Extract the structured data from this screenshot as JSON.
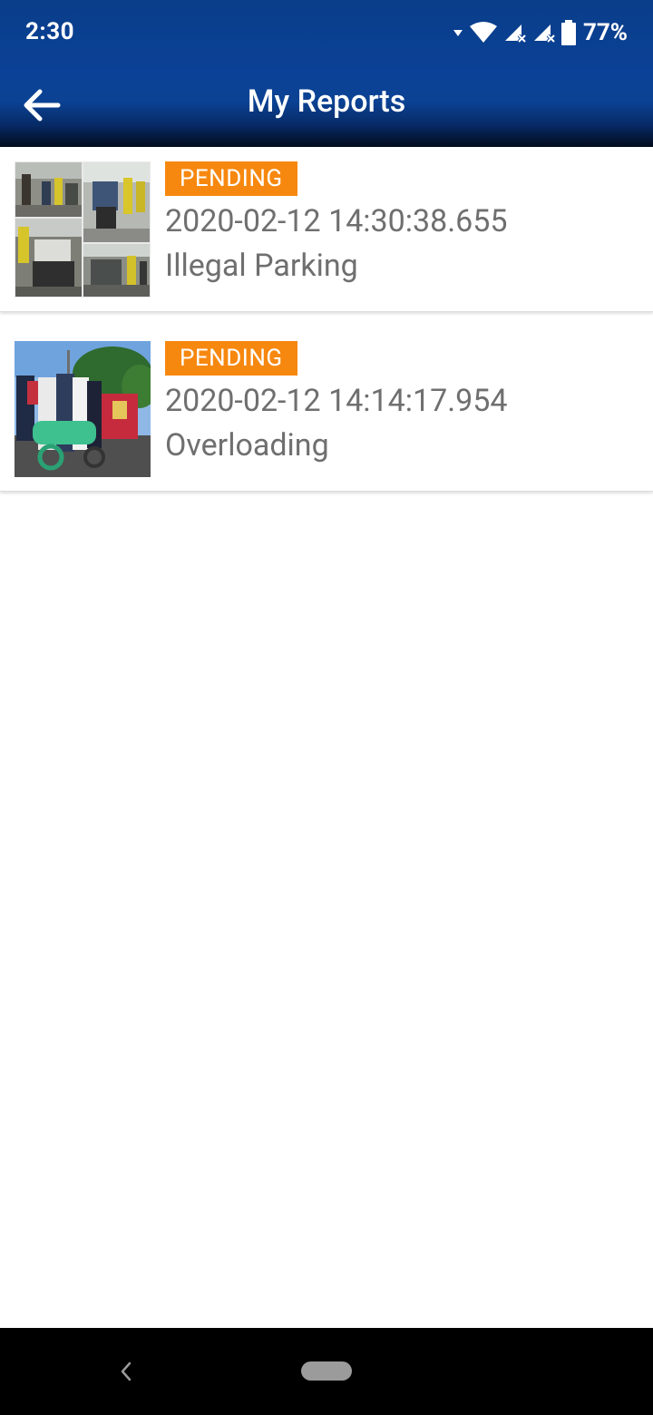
{
  "status_bar": {
    "time": "2:30",
    "battery_percent": "77%",
    "icons": [
      "notification-dropdown-icon",
      "wifi-icon",
      "signal-icon",
      "signal-icon",
      "battery-icon"
    ]
  },
  "app_bar": {
    "title": "My Reports",
    "back_icon": "arrow-left-icon",
    "background": "#0b4294",
    "foreground": "#ffffff"
  },
  "reports": [
    {
      "status": "PENDING",
      "datetime": "2020-02-12 14:30:38.655",
      "type": "Illegal Parking",
      "photo_count": 4
    },
    {
      "status": "PENDING",
      "datetime": "2020-02-12 14:14:17.954",
      "type": "Overloading",
      "photo_count": 1
    }
  ],
  "colors": {
    "badge_pending": "#f7880f",
    "text_secondary": "#6f6f6f",
    "nav_bar": "#000000"
  },
  "nav_bar": {
    "back_icon": "chevron-left-icon",
    "home_icon": "home-pill-icon"
  }
}
